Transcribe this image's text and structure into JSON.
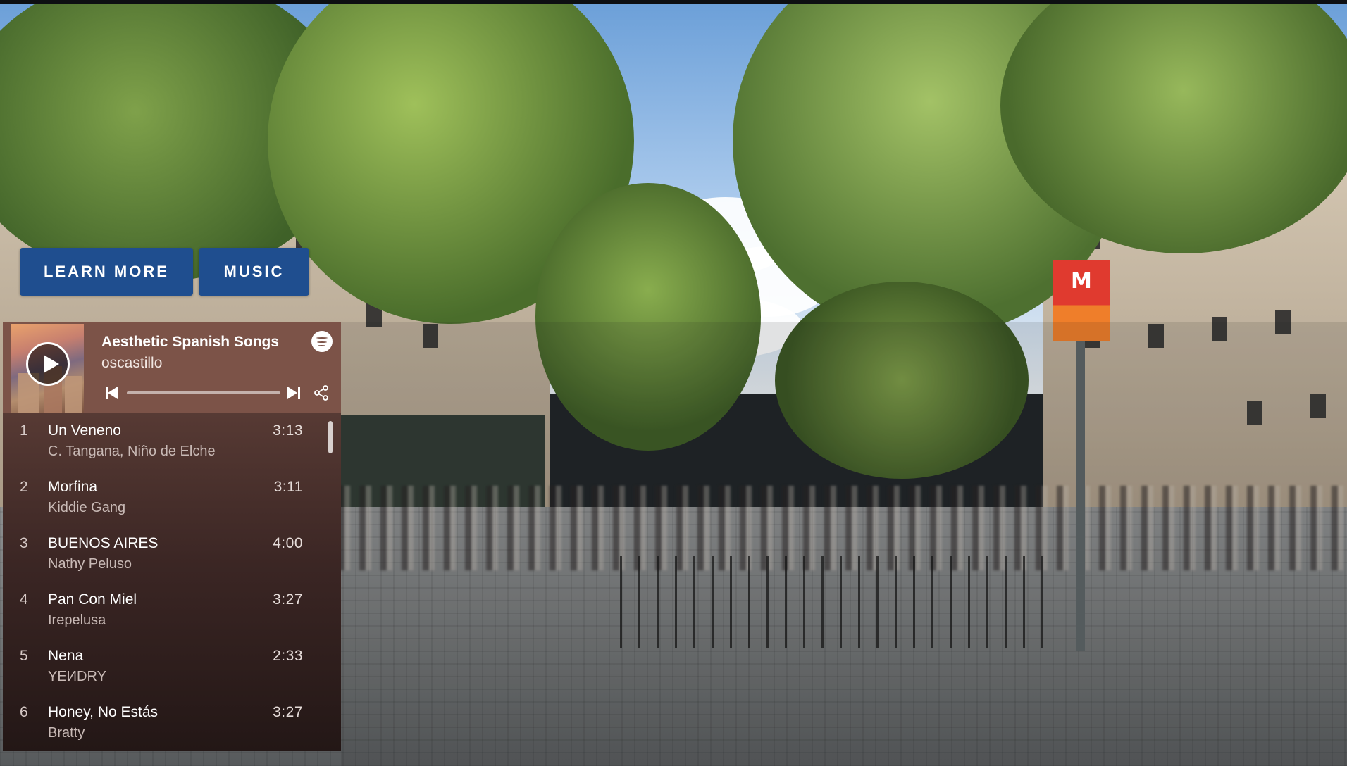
{
  "buttons": {
    "learn_more": "LEARN MORE",
    "music": "MUSIC"
  },
  "background": {
    "metro_sign_letter": "M"
  },
  "player": {
    "playlist_title": "Aesthetic Spanish Songs",
    "owner": "oscastillo",
    "progress": 0,
    "icons": [
      "play-icon",
      "spotify-icon",
      "previous-track-icon",
      "next-track-icon",
      "share-icon"
    ],
    "colors": {
      "header_bg": "#7c5348",
      "list_bg_top": "#573a34",
      "list_bg_bottom": "#231716",
      "button_blue": "#1f4e8f"
    },
    "tracks": [
      {
        "number": "1",
        "title": "Un Veneno",
        "artist": "C. Tangana, Niño de Elche",
        "duration": "3:13"
      },
      {
        "number": "2",
        "title": "Morfina",
        "artist": "Kiddie Gang",
        "duration": "3:11"
      },
      {
        "number": "3",
        "title": "BUENOS AIRES",
        "artist": "Nathy Peluso",
        "duration": "4:00"
      },
      {
        "number": "4",
        "title": "Pan Con Miel",
        "artist": "Irepelusa",
        "duration": "3:27"
      },
      {
        "number": "5",
        "title": "Nena",
        "artist": "YEИDRY",
        "duration": "2:33"
      },
      {
        "number": "6",
        "title": "Honey, No Estás",
        "artist": "Bratty",
        "duration": "3:27"
      }
    ]
  }
}
